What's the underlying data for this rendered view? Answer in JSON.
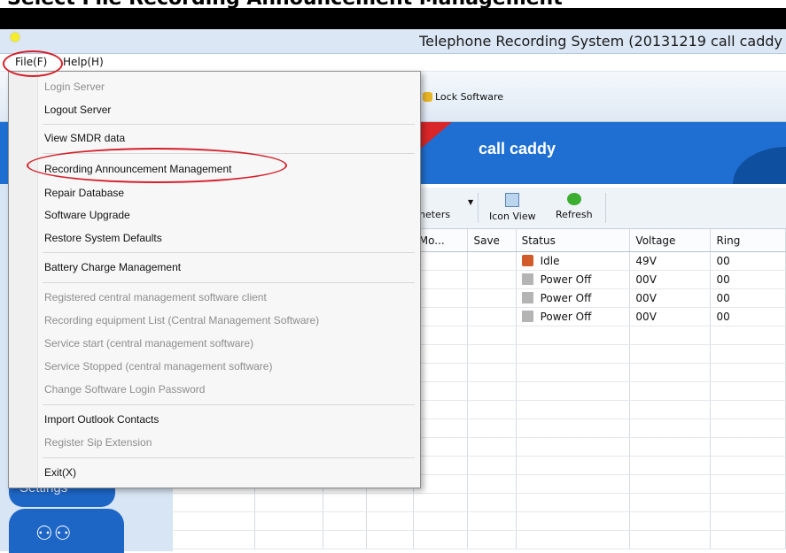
{
  "overlay_title": "Select File Recording Announcement Management",
  "window": {
    "title": "Telephone Recording System (20131219 call caddy"
  },
  "menubar": {
    "file": "File(F)",
    "help": "Help(H)"
  },
  "toolbar": {
    "lock": "Lock Software"
  },
  "banner": {
    "title": "call caddy"
  },
  "toolbar2": {
    "parameters": "neters",
    "icon_view": "Icon View",
    "refresh": "Refresh"
  },
  "grid": {
    "headers": [
      "Mo...",
      "Save",
      "Status",
      "Voltage",
      "Ring"
    ],
    "rows": [
      {
        "status": "Idle",
        "status_icon": "phone-idle-icon",
        "voltage": "49V",
        "ring": "00"
      },
      {
        "status": "Power Off",
        "status_icon": "power-off-icon",
        "voltage": "00V",
        "ring": "00"
      },
      {
        "status": "Power Off",
        "status_icon": "power-off-icon",
        "voltage": "00V",
        "ring": "00"
      },
      {
        "status": "Power Off",
        "status_icon": "power-off-icon",
        "voltage": "00V",
        "ring": "00"
      }
    ]
  },
  "left_panel": {
    "settings": "Settings",
    "team_icon": "users-icon"
  },
  "file_menu": {
    "items": [
      {
        "label": "Login Server",
        "enabled": false
      },
      {
        "label": "Logout Server",
        "enabled": true
      },
      {
        "label": "View SMDR data",
        "enabled": true
      },
      {
        "label": "Recording Announcement Management",
        "enabled": true
      },
      {
        "label": "Repair Database",
        "enabled": true
      },
      {
        "label": "Software Upgrade",
        "enabled": true
      },
      {
        "label": "Restore System Defaults",
        "enabled": true
      },
      {
        "label": "Battery Charge Management",
        "enabled": true
      },
      {
        "label": "Registered central management software client",
        "enabled": false
      },
      {
        "label": "Recording equipment List (Central Management Software)",
        "enabled": false
      },
      {
        "label": "Service start (central management software)",
        "enabled": false
      },
      {
        "label": "Service Stopped (central management software)",
        "enabled": false
      },
      {
        "label": "Change Software Login Password",
        "enabled": false
      },
      {
        "label": "Import Outlook Contacts",
        "enabled": true
      },
      {
        "label": "Register Sip Extension",
        "enabled": false
      },
      {
        "label": "Exit(X)",
        "enabled": true
      }
    ]
  },
  "colors": {
    "banner": "#1f6fd2",
    "annotation": "#d4202a",
    "accent_red": "#d92628"
  }
}
